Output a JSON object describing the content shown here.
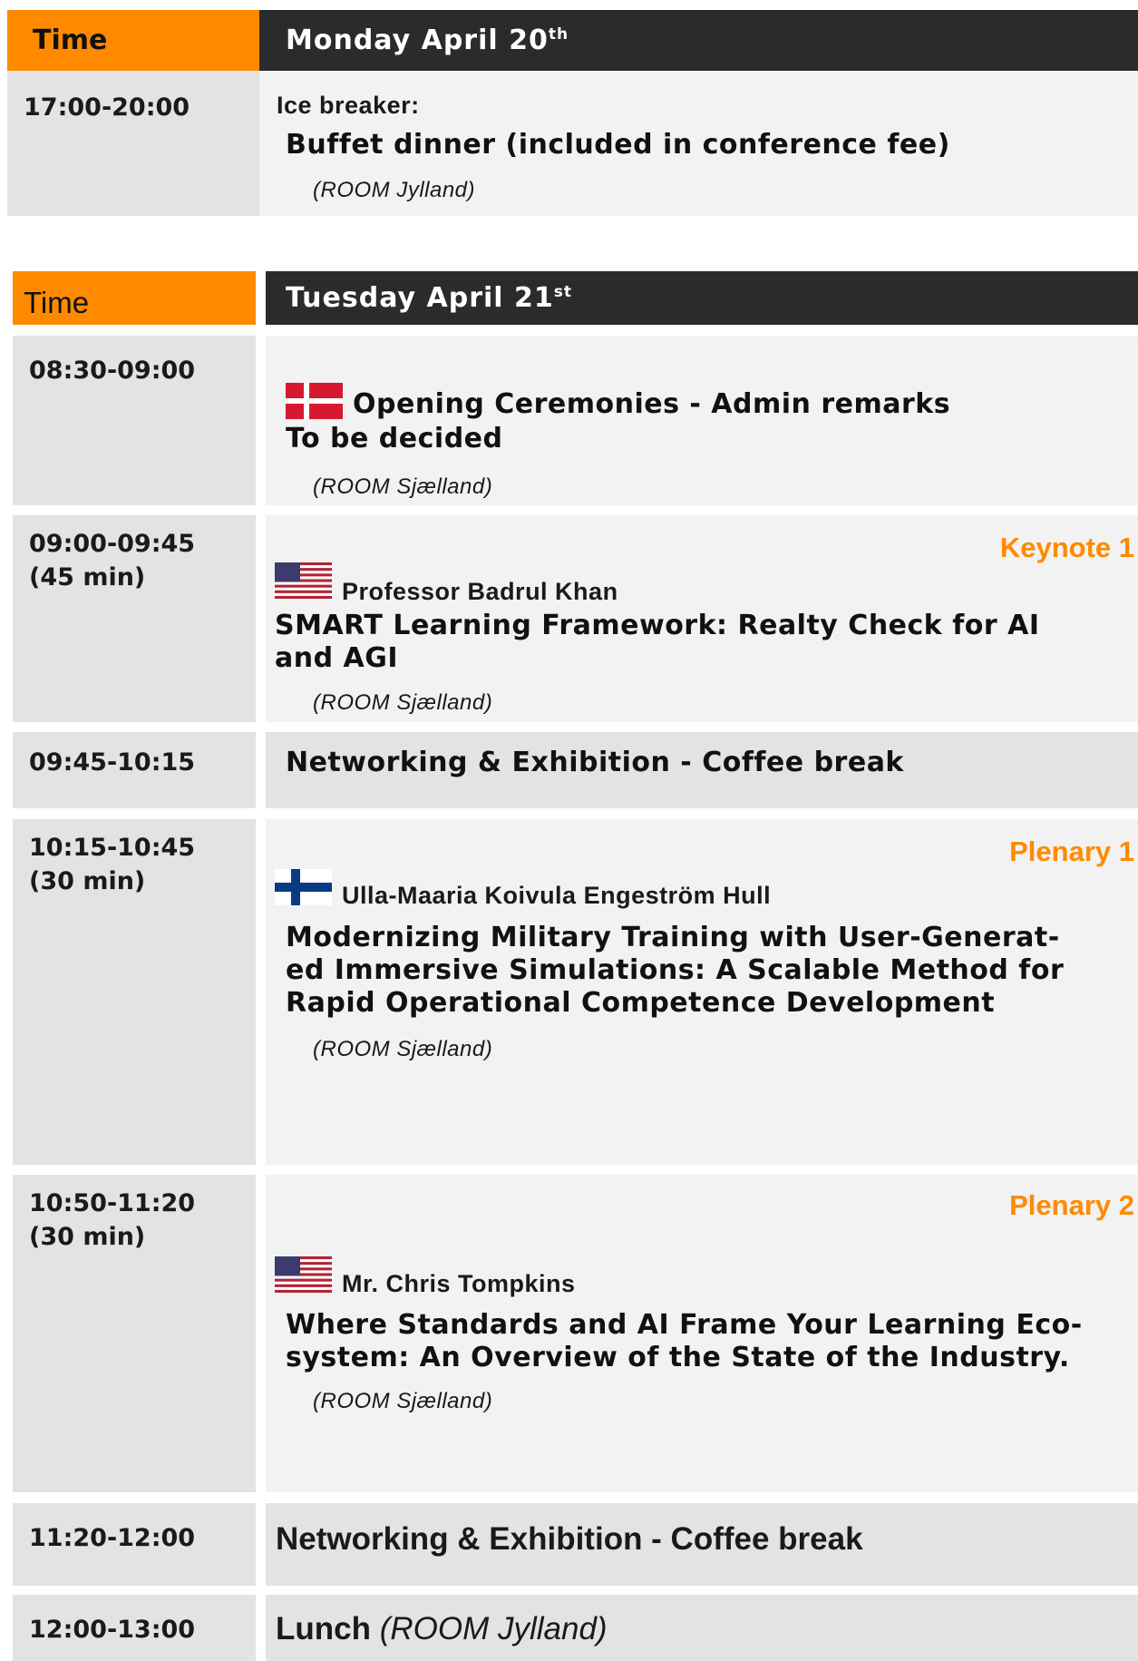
{
  "monday": {
    "time_header": "Time",
    "day_header": "Monday April 20",
    "day_sup": "th",
    "rows": [
      {
        "time": "17:00-20:00",
        "label": "Ice breaker:",
        "title": "Buffet dinner (included in conference fee)",
        "room": "(ROOM Jylland)"
      }
    ]
  },
  "tuesday": {
    "time_header": "Time",
    "day_header": "Tuesday April 21",
    "day_sup": "st",
    "rows": [
      {
        "time": "08:30-09:00",
        "flag": "denmark-flag",
        "title": "Opening Ceremonies - Admin remarks",
        "subtitle": "To be decided",
        "room": "(ROOM  Sjælland)"
      },
      {
        "time": "09:00-09:45",
        "duration": "(45 min)",
        "tag": "Keynote 1",
        "flag": "usa-flag",
        "speaker": "Professor Badrul Khan",
        "title_lines": [
          "SMART Learning Framework:  Realty Check for AI",
          "and AGI"
        ],
        "room": "(ROOM Sjælland)"
      },
      {
        "time": "09:45-10:15",
        "title": "Networking & Exhibition - Coffee break"
      },
      {
        "time": "10:15-10:45",
        "duration": "(30 min)",
        "tag": "Plenary 1",
        "flag": "finland-flag",
        "speaker": "Ulla-Maaria Koivula Engeström Hull",
        "title_lines": [
          "Modernizing Military Training with User-Generat-",
          "ed Immersive Simulations: A Scalable Method for",
          "Rapid Operational Competence Development"
        ],
        "room": "(ROOM Sjælland)"
      },
      {
        "time": "10:50-11:20",
        "duration": "(30 min)",
        "tag": "Plenary 2",
        "flag": "usa-flag",
        "speaker": "Mr. Chris Tompkins",
        "title_lines": [
          "Where Standards and AI Frame Your Learning Eco-",
          "system: An Overview of the State of the Industry."
        ],
        "room": "(ROOM Sjælland)"
      },
      {
        "time": "11:20-12:00",
        "title": "Networking & Exhibition - Coffee break"
      },
      {
        "time": "12:00-13:00",
        "title": "Lunch",
        "room": "(ROOM Jylland)"
      }
    ]
  },
  "colors": {
    "accent_orange": "#ff8a00",
    "header_dark": "#2b2b2b",
    "cell_gray": "#e3e3e3",
    "cell_light": "#f2f2f2"
  }
}
